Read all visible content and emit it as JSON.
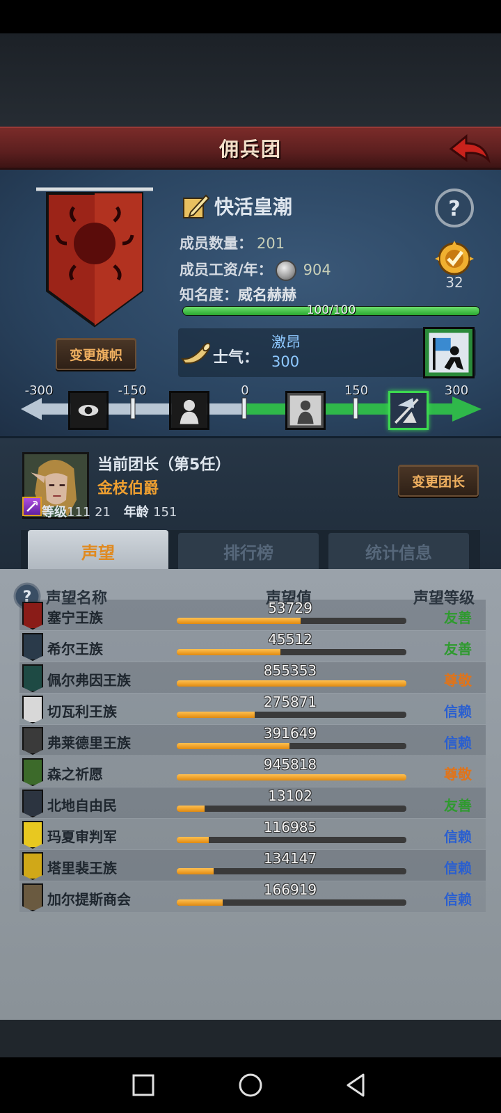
{
  "title": "佣兵团",
  "guild": {
    "name": "快活皇潮",
    "members_label": "成员数量：",
    "members": "201",
    "salary_label": "成员工资/年：",
    "salary": "904",
    "fame_label": "知名度：",
    "fame_level": "威名赫赫",
    "fame_progress": "100/100",
    "fame_fraction": 1.0,
    "medal_count": "32",
    "change_flag_label": "变更旗帜"
  },
  "morale": {
    "label": "士气：",
    "state": "激昂",
    "value": "300",
    "scale_ticks": [
      "-300",
      "-150",
      "0",
      "150",
      "300"
    ],
    "scale_value": 300
  },
  "leader": {
    "title": "当前团长（第5任）",
    "name": "金枝伯爵",
    "level_label": "等级",
    "level": "111 21",
    "age_label": "年龄",
    "age": "151",
    "change_leader_label": "变更团长"
  },
  "tabs": [
    {
      "label": "声望",
      "active": true
    },
    {
      "label": "排行榜",
      "active": false
    },
    {
      "label": "统计信息",
      "active": false
    }
  ],
  "reputation": {
    "headers": {
      "name": "声望名称",
      "value": "声望值",
      "level": "声望等级"
    },
    "rows": [
      {
        "name": "塞宁王族",
        "value": "53729",
        "fill": 0.54,
        "level": "友善",
        "color": "#2f9a2f",
        "crest": "#8a1c18"
      },
      {
        "name": "希尔王族",
        "value": "45512",
        "fill": 0.45,
        "level": "友善",
        "color": "#2f9a2f",
        "crest": "#2a3a4a"
      },
      {
        "name": "佩尔弗因王族",
        "value": "855353",
        "fill": 1.0,
        "level": "尊敬",
        "color": "#e0741a",
        "crest": "#1e4a44"
      },
      {
        "name": "切瓦利王族",
        "value": "275871",
        "fill": 0.34,
        "level": "信赖",
        "color": "#2a5fd0",
        "crest": "#d8d8d8"
      },
      {
        "name": "弗莱德里王族",
        "value": "391649",
        "fill": 0.49,
        "level": "信赖",
        "color": "#2a5fd0",
        "crest": "#3a3a3a"
      },
      {
        "name": "森之祈愿",
        "value": "945818",
        "fill": 1.0,
        "level": "尊敬",
        "color": "#e0741a",
        "crest": "#3c6a2a"
      },
      {
        "name": "北地自由民",
        "value": "13102",
        "fill": 0.12,
        "level": "友善",
        "color": "#2f9a2f",
        "crest": "#2c3440"
      },
      {
        "name": "玛夏审判军",
        "value": "116985",
        "fill": 0.14,
        "level": "信赖",
        "color": "#2a5fd0",
        "crest": "#e8c820"
      },
      {
        "name": "塔里裴王族",
        "value": "134147",
        "fill": 0.16,
        "level": "信赖",
        "color": "#2a5fd0",
        "crest": "#d0a818"
      },
      {
        "name": "加尔提斯商会",
        "value": "166919",
        "fill": 0.2,
        "level": "信赖",
        "color": "#2a5fd0",
        "crest": "#6a5a40"
      }
    ]
  },
  "colors": {
    "accent_orange": "#f0a030",
    "morale_blue": "#8ec8ff",
    "fame_green": "#2aa830"
  },
  "icons": [
    "back-arrow-icon",
    "edit-icon",
    "help-icon",
    "medal-icon",
    "horn-icon",
    "coin-icon"
  ]
}
